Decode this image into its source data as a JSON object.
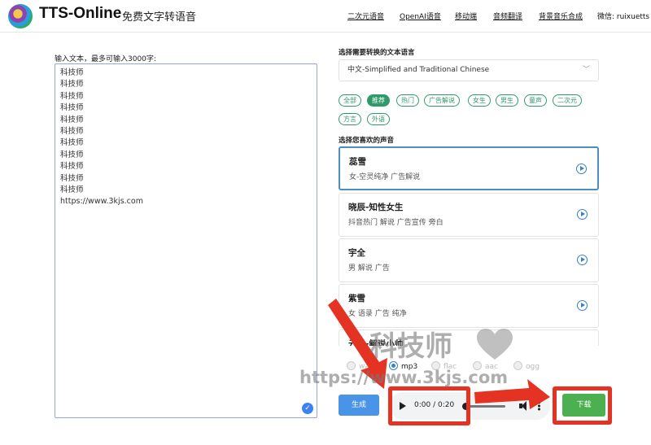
{
  "header": {
    "brand": "TTS-Online",
    "subtitle": "免费文字转语音",
    "nav": [
      "二次元语音",
      "OpenAI语音",
      "移动端",
      "音频翻译",
      "背景音乐合成"
    ],
    "wechat": "微信: ruixuetts"
  },
  "input": {
    "label": "输入文本，最多可输入3000字:",
    "text": "科技师\n科技师\n科技师\n科技师\n科技师\n科技师\n科技师\n科技师\n科技师\n科技师\n科技师\nhttps://www.3kjs.com"
  },
  "language": {
    "label": "选择需要转换的文本语言",
    "selected": "中文-Simplified and Traditional Chinese"
  },
  "filters": [
    "全部",
    "推荐",
    "热门",
    "广告解说",
    "女生",
    "男生",
    "童声",
    "二次元",
    "方言",
    "外语"
  ],
  "active_filter": "推荐",
  "voices": {
    "label": "选择您喜欢的声音",
    "items": [
      {
        "name": "蕊雪",
        "desc": "女-空灵纯净 广告解说"
      },
      {
        "name": "晓辰-知性女生",
        "desc": "抖音热门 解说 广告宣传 旁白"
      },
      {
        "name": "宇全",
        "desc": "男 解说 广告"
      },
      {
        "name": "紫雪",
        "desc": "女 语录 广告 纯净"
      },
      {
        "name": "云希-解说小帅",
        "desc": ""
      }
    ]
  },
  "formats": [
    "wav",
    "mp3",
    "flac",
    "aac",
    "ogg"
  ],
  "selected_format": "mp3",
  "actions": {
    "generate": "生成",
    "download": "下载"
  },
  "player": {
    "time": "0:00 / 0:20",
    "progress": 0
  },
  "watermark": {
    "title": "科技师",
    "url": "https://www.3kjs.com"
  },
  "colors": {
    "accent_green": "#2e9a6a",
    "generate_blue": "#4a94e8",
    "download_green": "#4caf50",
    "highlight_red": "#e53323"
  }
}
